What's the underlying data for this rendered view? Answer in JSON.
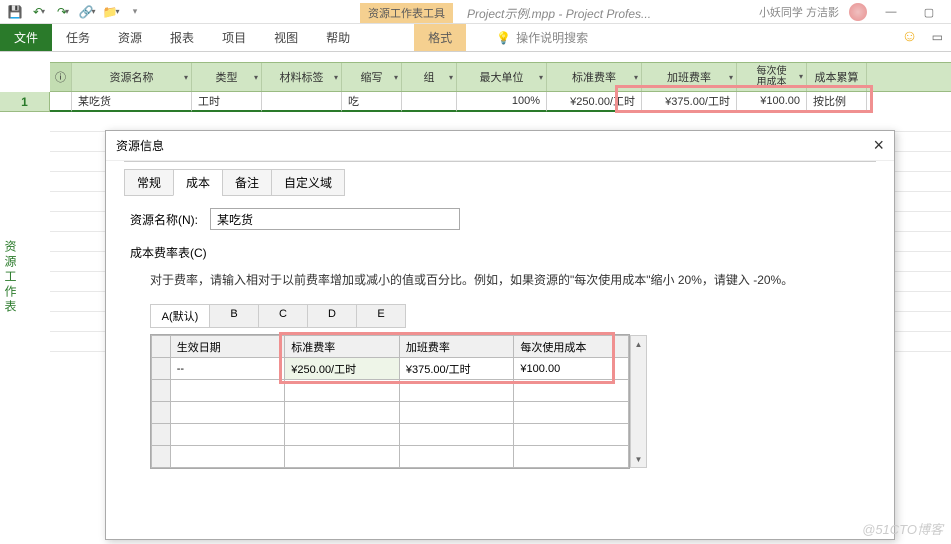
{
  "qat": {
    "save": "💾"
  },
  "title": {
    "context_tab": "资源工作表工具",
    "doc": "Project示例.mpp  -  Project Profes..."
  },
  "user": {
    "name": "小妖同学 方洁影"
  },
  "ribbon": {
    "file": "文件",
    "tabs": [
      "任务",
      "资源",
      "报表",
      "项目",
      "视图",
      "帮助"
    ],
    "format": "格式",
    "tell_me": "操作说明搜索"
  },
  "columns": {
    "info": "ⓘ",
    "name": "资源名称",
    "type": "类型",
    "material": "材料标签",
    "initials": "缩写",
    "group": "组",
    "max": "最大单位",
    "std": "标准费率",
    "ovt": "加班费率",
    "per": "每次使\n用成本",
    "accrue": "成本累算"
  },
  "row": {
    "num": "1",
    "name": "某吃货",
    "type": "工时",
    "material": "",
    "initials": "吃",
    "group": "",
    "max": "100%",
    "std": "¥250.00/工时",
    "ovt": "¥375.00/工时",
    "per": "¥100.00",
    "accrue": "按比例"
  },
  "side_label": "资源工作表",
  "dialog": {
    "title": "资源信息",
    "tabs": {
      "general": "常规",
      "cost": "成本",
      "notes": "备注",
      "custom": "自定义域"
    },
    "name_label": "资源名称(N):",
    "name_value": "某吃货",
    "table_label": "成本费率表(C)",
    "hint": "对于费率，请输入相对于以前费率增加或减小的值或百分比。例如，如果资源的\"每次使用成本\"缩小 20%，请键入  -20%。",
    "rate_tabs": {
      "a": "A(默认)",
      "b": "B",
      "c": "C",
      "d": "D",
      "e": "E"
    },
    "grid": {
      "h_date": "生效日期",
      "h_std": "标准费率",
      "h_ovt": "加班费率",
      "h_per": "每次使用成本",
      "r_date": "--",
      "r_std": "¥250.00/工时",
      "r_ovt": "¥375.00/工时",
      "r_per": "¥100.00"
    }
  },
  "watermark": "@51CTO博客"
}
